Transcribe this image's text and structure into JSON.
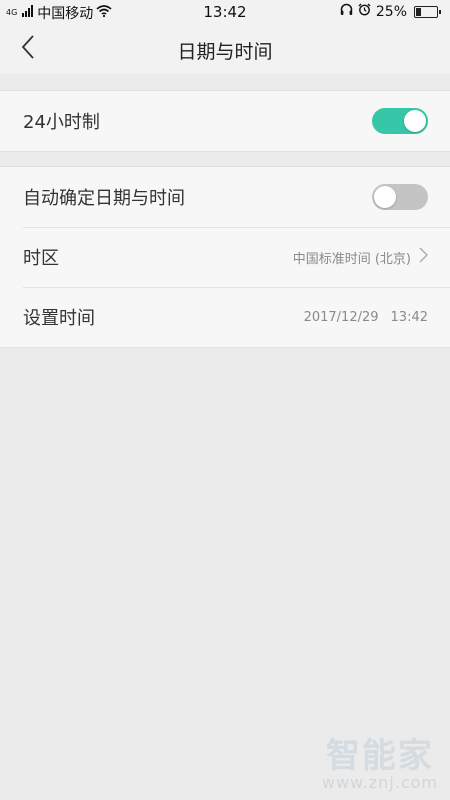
{
  "status_bar": {
    "network_type": "4G",
    "carrier": "中国移动",
    "time": "13:42",
    "battery_percent": "25%",
    "battery_level": 0.25,
    "icons": [
      "signal-icon",
      "wifi-icon",
      "headphone-icon",
      "alarm-icon",
      "battery-icon"
    ]
  },
  "header": {
    "title": "日期与时间",
    "back_icon": "chevron-left-icon"
  },
  "settings": {
    "hour24": {
      "label": "24小时制",
      "enabled": true
    },
    "auto_datetime": {
      "label": "自动确定日期与时间",
      "enabled": false
    },
    "timezone": {
      "label": "时区",
      "value": "中国标准时间 (北京)"
    },
    "set_time": {
      "label": "设置时间",
      "date": "2017/12/29",
      "time": "13:42"
    }
  },
  "colors": {
    "accent": "#37c6a7",
    "toggle_off": "#c4c4c4",
    "background": "#ebebeb"
  },
  "watermark": {
    "brand": "智能家",
    "url": "www.znj.com"
  }
}
